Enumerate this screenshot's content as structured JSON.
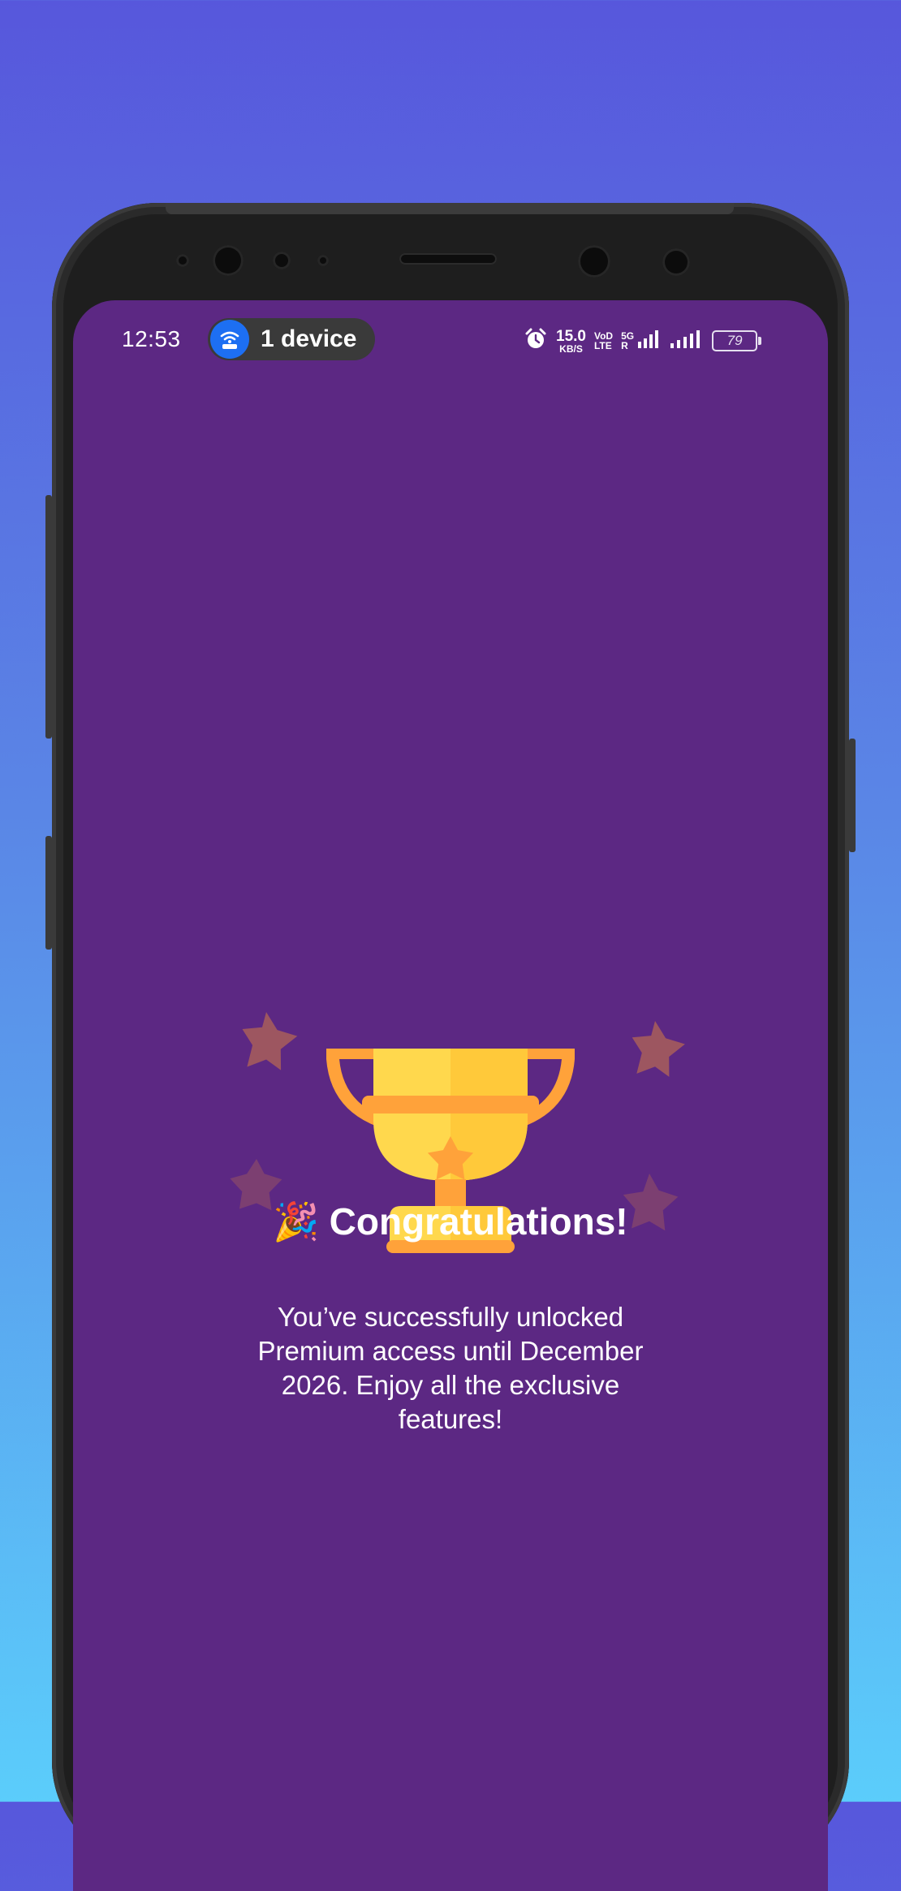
{
  "status_bar": {
    "time": "12:53",
    "hotspot_label": "1 device",
    "net_speed_value": "15.0",
    "net_speed_unit": "KB/S",
    "volte_top": "VoD",
    "volte_bottom": "LTE",
    "network_type": "5G",
    "roaming_mark": "R",
    "battery_level": "79",
    "icons": [
      "wifi-hotspot-icon",
      "alarm-icon",
      "signal-icon",
      "battery-icon"
    ]
  },
  "success": {
    "emoji": "🎉",
    "title": "Congratulations!",
    "message": "You’ve successfully unlocked Premium access until December 2026. Enjoy all the exclusive features!"
  },
  "colors": {
    "screen_background": "#5c2883",
    "trophy_gold": "#ffd84d",
    "trophy_orange": "#ffa23a",
    "hotspot_blue": "#1d6ff2"
  }
}
